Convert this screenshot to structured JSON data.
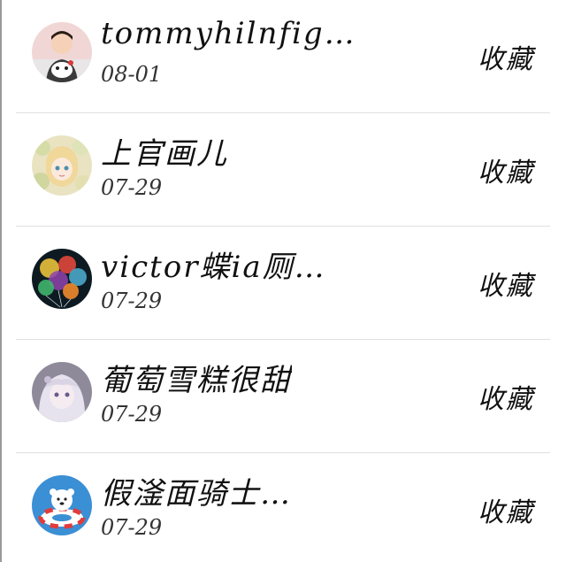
{
  "list": {
    "items": [
      {
        "name": "tommyhilnfig…",
        "date": "08-01",
        "action": "收藏",
        "avatar": "user-avatar-boy"
      },
      {
        "name": "上官画儿",
        "date": "07-29",
        "action": "收藏",
        "avatar": "user-avatar-doll"
      },
      {
        "name": "victor蝶ia厕…",
        "date": "07-29",
        "action": "收藏",
        "avatar": "user-avatar-balloons"
      },
      {
        "name": "葡萄雪糕很甜",
        "date": "07-29",
        "action": "收藏",
        "avatar": "user-avatar-anime-girl"
      },
      {
        "name": "假滏面骑士…",
        "date": "07-29",
        "action": "收藏",
        "avatar": "user-avatar-bear"
      }
    ]
  }
}
